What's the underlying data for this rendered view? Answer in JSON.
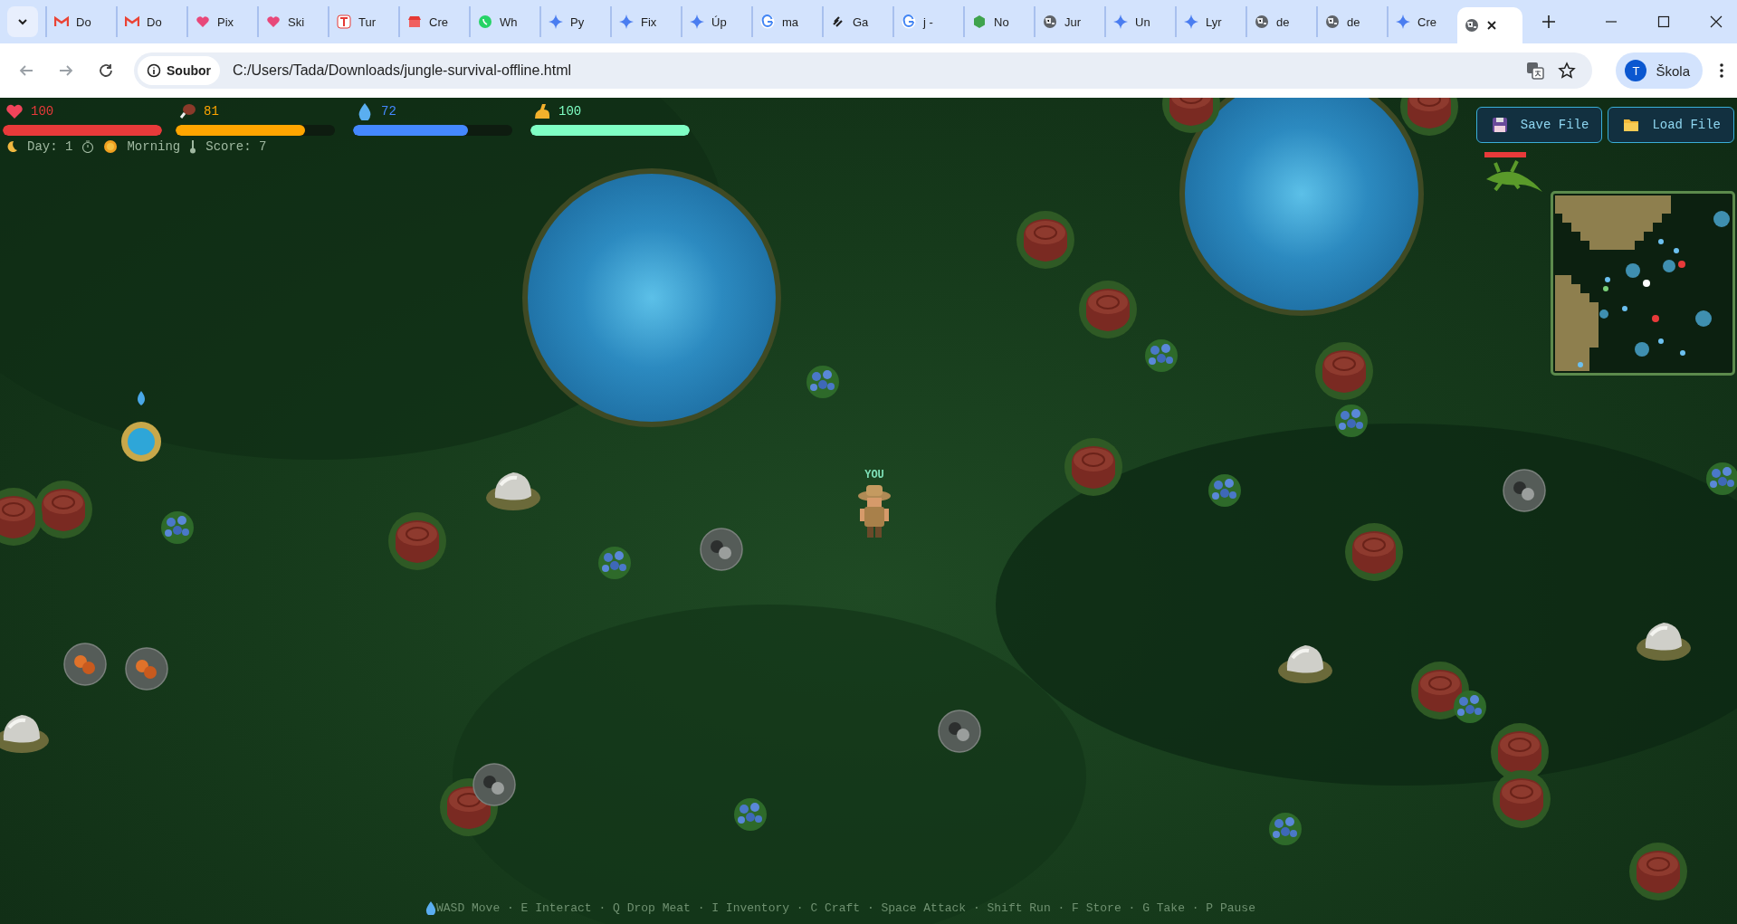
{
  "browser": {
    "tabs": [
      {
        "title": "Do",
        "kind": "mail",
        "selected": false
      },
      {
        "title": "Do",
        "kind": "mail",
        "selected": false
      },
      {
        "title": "Pix",
        "kind": "heart",
        "selected": false
      },
      {
        "title": "Ski",
        "kind": "heart",
        "selected": false
      },
      {
        "title": "Tur",
        "kind": "letter",
        "selected": false
      },
      {
        "title": "Cre",
        "kind": "shop",
        "selected": false
      },
      {
        "title": "Wh",
        "kind": "chat",
        "selected": false
      },
      {
        "title": "Py",
        "kind": "sparkle",
        "selected": false
      },
      {
        "title": "Fix",
        "kind": "sparkle",
        "selected": false
      },
      {
        "title": "Úp",
        "kind": "sparkle",
        "selected": false
      },
      {
        "title": "ma",
        "kind": "g",
        "selected": false
      },
      {
        "title": "Ga",
        "kind": "link",
        "selected": false
      },
      {
        "title": "j -",
        "kind": "g",
        "selected": false
      },
      {
        "title": "No",
        "kind": "hexagon",
        "selected": false
      },
      {
        "title": "Jur",
        "kind": "globe",
        "selected": false
      },
      {
        "title": "Un",
        "kind": "sparkle",
        "selected": false
      },
      {
        "title": "Lyr",
        "kind": "sparkle",
        "selected": false
      },
      {
        "title": "de",
        "kind": "globe",
        "selected": false
      },
      {
        "title": "de",
        "kind": "globe",
        "selected": false
      },
      {
        "title": "Cre",
        "kind": "sparkle",
        "selected": false
      },
      {
        "kind": "globe",
        "selected": true
      }
    ],
    "site_chip": "Soubor",
    "url": "C:/Users/Tada/Downloads/jungle-survival-offline.html",
    "profile": {
      "initial": "T",
      "name": "Škola"
    }
  },
  "game": {
    "stats": [
      {
        "kind": "health",
        "value": "100",
        "level": 1.0,
        "color": "#e83a3a"
      },
      {
        "kind": "food",
        "value": "81",
        "level": 0.81,
        "color": "#ffa500"
      },
      {
        "kind": "water",
        "value": "72",
        "level": 0.72,
        "color": "#4488ff"
      },
      {
        "kind": "stamina",
        "value": "100",
        "level": 1.0,
        "color": "#7fffc4"
      }
    ],
    "status": {
      "day": "Day: 1",
      "time_of_day": "Morning",
      "score": "Score: 7"
    },
    "buttons": [
      "Save File",
      "Load File"
    ],
    "player_label": "YOU",
    "controls_hint": "WASD Move · E Interact · Q Drop Meat · I Inventory · C Craft · Space Attack · Shift Run · F Store · G Take · P Pause"
  }
}
